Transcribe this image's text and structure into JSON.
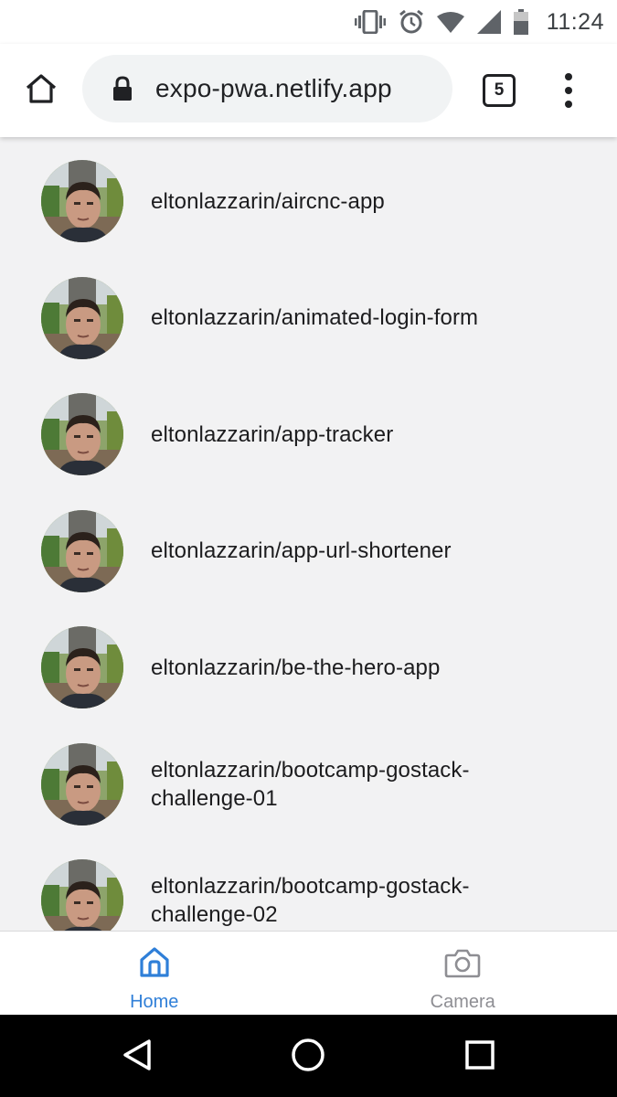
{
  "status_bar": {
    "time": "11:24",
    "icons": [
      "vibrate-icon",
      "alarm-icon",
      "wifi-icon",
      "signal-icon",
      "battery-icon"
    ]
  },
  "browser": {
    "url": "expo-pwa.netlify.app",
    "tab_count": "5",
    "icons": [
      "home-icon",
      "lock-icon",
      "more-vert-icon"
    ]
  },
  "repos": [
    {
      "name": "eltonlazzarin/aircnc-app"
    },
    {
      "name": "eltonlazzarin/animated-login-form"
    },
    {
      "name": "eltonlazzarin/app-tracker"
    },
    {
      "name": "eltonlazzarin/app-url-shortener"
    },
    {
      "name": "eltonlazzarin/be-the-hero-app"
    },
    {
      "name": "eltonlazzarin/bootcamp-gostack-challenge-01"
    },
    {
      "name": "eltonlazzarin/bootcamp-gostack-challenge-02"
    }
  ],
  "tab_bar": {
    "home_label": "Home",
    "camera_label": "Camera",
    "active_color": "#2f7fd8",
    "inactive_color": "#8e8e93"
  },
  "nav_bar": {
    "icons": [
      "back-icon",
      "home-circle-icon",
      "recents-icon"
    ]
  }
}
